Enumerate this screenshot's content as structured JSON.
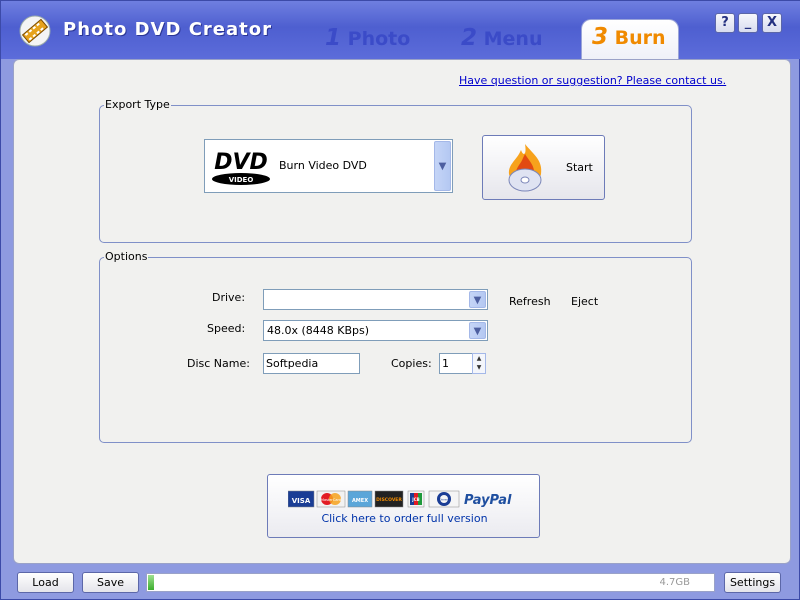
{
  "app": {
    "title": "Photo DVD Creator"
  },
  "steps": [
    {
      "num": "1",
      "label": "Photo"
    },
    {
      "num": "2",
      "label": "Menu"
    },
    {
      "num": "3",
      "label": "Burn"
    }
  ],
  "window_buttons": {
    "help": "?",
    "minimize": "_",
    "close": "X"
  },
  "contact_link": "Have question or suggestion? Please contact us.",
  "export": {
    "legend": "Export Type",
    "selected": "Burn Video DVD",
    "logo_text": "DVD",
    "logo_subtext": "VIDEO",
    "start_label": "Start"
  },
  "options": {
    "legend": "Options",
    "drive_label": "Drive:",
    "drive_value": "",
    "refresh_label": "Refresh",
    "eject_label": "Eject",
    "speed_label": "Speed:",
    "speed_value": "48.0x (8448 KBps)",
    "disc_name_label": "Disc Name:",
    "disc_name_value": "Softpedia",
    "copies_label": "Copies:",
    "copies_value": "1"
  },
  "order": {
    "label": "Click here to order full version",
    "cards": [
      "VISA",
      "MasterCard",
      "AMEX",
      "DISCOVER",
      "JCB",
      "Diners",
      "PayPal"
    ]
  },
  "bottom": {
    "load_label": "Load",
    "save_label": "Save",
    "settings_label": "Settings",
    "capacity_text": "4.7GB",
    "capacity_fraction": 0.01
  },
  "colors": {
    "titlebar": "#5060d2",
    "burn_tab": "#f08a00",
    "step_tab": "#3b4bc8",
    "link": "#0000cc"
  },
  "icons": {
    "app_logo": "film-strip-pencil-icon",
    "burn": "burning-disc-icon"
  }
}
